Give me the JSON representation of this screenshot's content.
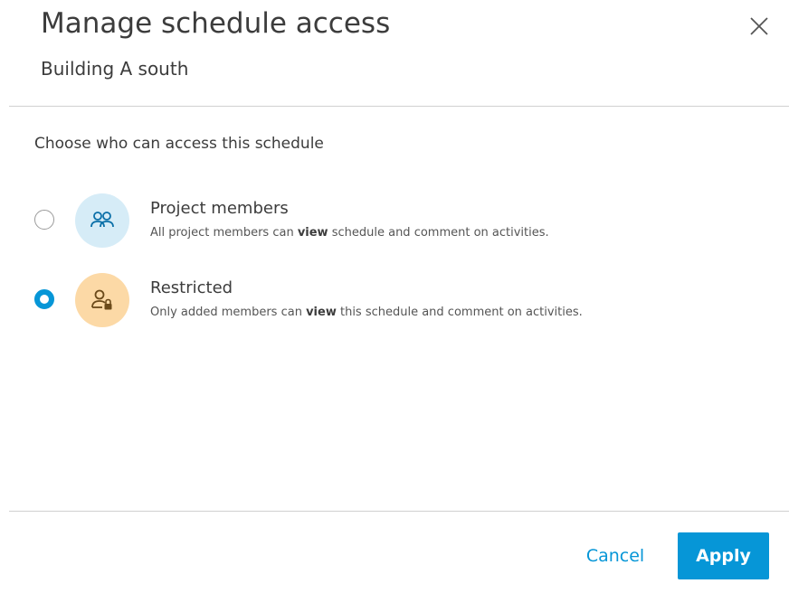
{
  "dialog": {
    "title": "Manage schedule access",
    "subtitle": "Building A south",
    "close_icon": "close-icon"
  },
  "access": {
    "prompt": "Choose who can access this schedule",
    "selected": "restricted",
    "options": [
      {
        "id": "project-members",
        "title": "Project members",
        "icon": "people-icon",
        "icon_bg": "#d6ecf7",
        "desc_before": "All project members can ",
        "desc_bold": "view",
        "desc_after": " schedule and comment on activities.",
        "checked": false
      },
      {
        "id": "restricted",
        "title": "Restricted",
        "icon": "user-lock-icon",
        "icon_bg": "#fcd9a6",
        "desc_before": "Only added members can ",
        "desc_bold": "view",
        "desc_after": " this schedule and comment on activities.",
        "checked": true
      }
    ]
  },
  "footer": {
    "cancel_label": "Cancel",
    "apply_label": "Apply"
  },
  "colors": {
    "accent": "#0696d7",
    "text": "#3c3c3c",
    "divider": "#d0d0d0"
  }
}
